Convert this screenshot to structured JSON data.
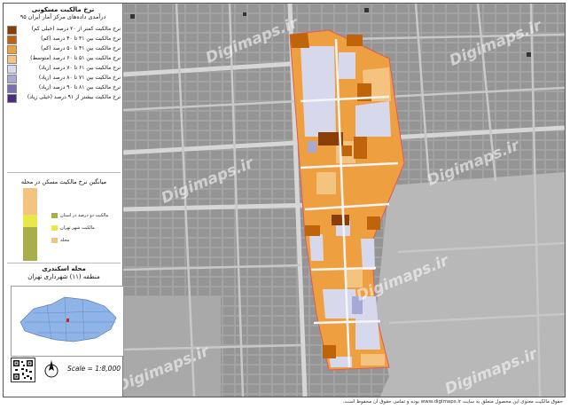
{
  "panel": {
    "title": "نرخ مالکیت مسکونی",
    "subtitle": "درآمدی داده‌های مرکز آمار ایران ۹۵"
  },
  "legend": [
    {
      "label": "نرخ مالکیت کمتر از ۲۰ درصد (خیلی کم)",
      "color": "#8b3d06"
    },
    {
      "label": "نرخ مالکیت بین ۳۱ تا ۴۰ درصد (کم)",
      "color": "#c0640c"
    },
    {
      "label": "نرخ مالکیت بین ۴۱ تا ۵۰ درصد (کم)",
      "color": "#eea040"
    },
    {
      "label": "نرخ مالکیت بین ۵۱ تا ۶۰ درصد (متوسط)",
      "color": "#f4c37f"
    },
    {
      "label": "نرخ مالکیت بین ۶۱ تا ۷۰ درصد (زیاد)",
      "color": "#d8d8ec"
    },
    {
      "label": "نرخ مالکیت بین ۷۱ تا ۸۰ درصد (زیاد)",
      "color": "#a8a8d6"
    },
    {
      "label": "نرخ مالکیت بین ۸۱ تا ۹۰ درصد (زیاد)",
      "color": "#7a6fb3"
    },
    {
      "label": "نرخ مالکیت بیشتر از ۹۱ درصد (خیلی زیاد)",
      "color": "#4a2a86"
    }
  ],
  "chart": {
    "title": "میانگین نرخ مالکیت مسکن در محله",
    "items": [
      {
        "label": "مالکیت دو درصد در استان",
        "color": "#a8ae4a"
      },
      {
        "label": "مالکیت شهر تهران",
        "color": "#e8e84a"
      },
      {
        "label": "محله",
        "color": "#f4c37f"
      }
    ]
  },
  "neighborhood": {
    "name": "محله اسکندری",
    "region": "منطقه (۱۱) شهرداری تهران"
  },
  "scale": "Scale = 1:8,000",
  "watermarks": [
    "Digimaps.ir",
    "Digimaps.ir",
    "Digimaps.ir",
    "Digimaps.ir",
    "Digimaps.ir",
    "Digimaps.ir",
    "Digimaps.ir"
  ],
  "footer": "حقوق مالکیت معنوی این محصول متعلق به سایت www.digimaps.ir بوده و تمامی حقوق آن محفوظ است."
}
